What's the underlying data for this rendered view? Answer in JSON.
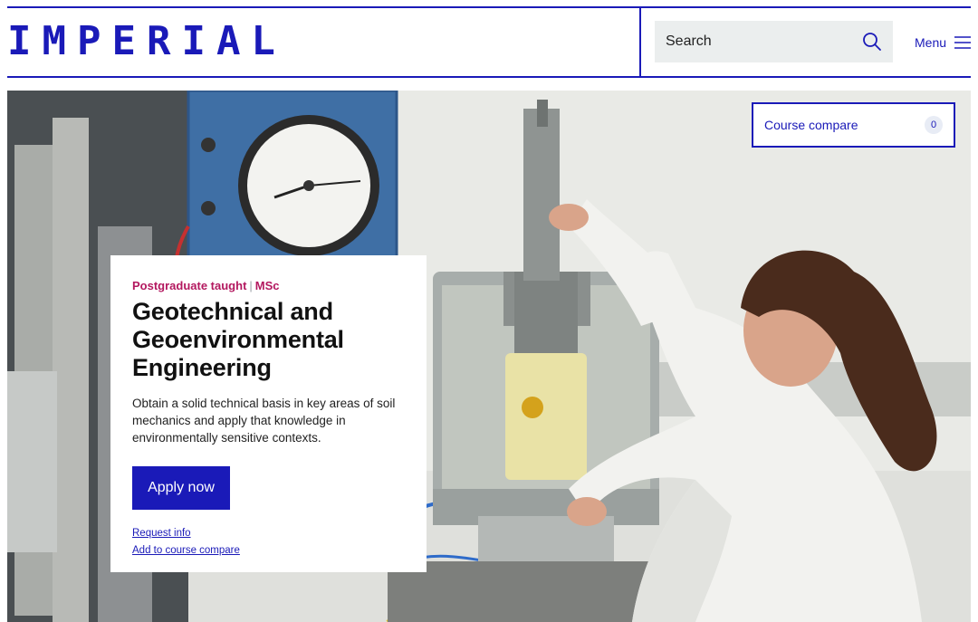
{
  "header": {
    "logo_text": "IMPERIAL",
    "search_label": "Search",
    "menu_label": "Menu"
  },
  "compare": {
    "label": "Course compare",
    "count": "0"
  },
  "course": {
    "level": "Postgraduate taught",
    "separator": "|",
    "award": "MSc",
    "title": "Geotechnical and Geoenvironmental Engineering",
    "description": "Obtain a solid technical basis in key areas of soil mechanics and apply that knowledge in environmentally sensitive contexts.",
    "apply_label": "Apply now",
    "request_info_label": "Request info",
    "add_compare_label": "Add to course compare"
  },
  "colors": {
    "brand_blue": "#1a1ab8",
    "kicker_magenta": "#b3185f",
    "search_bg": "#ebeeee"
  },
  "icons": [
    "search-icon",
    "menu-icon"
  ]
}
